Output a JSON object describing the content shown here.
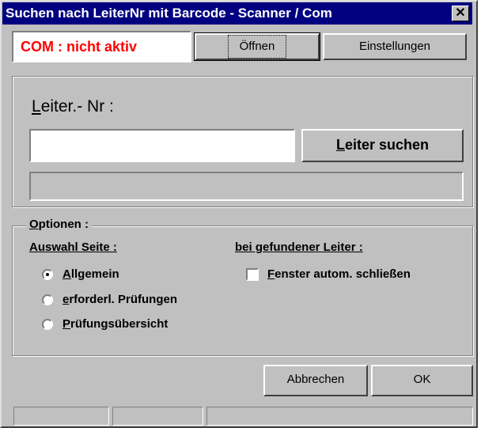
{
  "window": {
    "title": "Suchen nach LeiterNr mit Barcode - Scanner / Com",
    "close_glyph": "✕"
  },
  "com": {
    "status": "COM : nicht aktiv",
    "status_color": "#ff0000",
    "open_label": "Öffnen",
    "settings_label": "Einstellungen"
  },
  "search": {
    "heading_accel": "L",
    "heading_rest": "eiter.- Nr :",
    "input_value": "",
    "button_accel": "L",
    "button_rest": "eiter suchen",
    "result_text": ""
  },
  "options": {
    "group_accel": "O",
    "group_rest": "ptionen :",
    "page_heading": "Auswahl Seite :",
    "radios": [
      {
        "accel": "A",
        "rest": "llgemein",
        "selected": true
      },
      {
        "accel": "e",
        "rest": "rforderl. Prüfungen",
        "selected": false
      },
      {
        "accel": "P",
        "rest": "rüfungsübersicht",
        "selected": false
      }
    ],
    "found_heading": "bei gefundener Leiter :",
    "checkbox": {
      "accel": "F",
      "rest": "enster autom. schließen",
      "checked": false
    }
  },
  "footer": {
    "cancel_label": "Abbrechen",
    "ok_label": "OK"
  },
  "statusbar": {
    "cells": [
      "",
      "",
      ""
    ]
  }
}
